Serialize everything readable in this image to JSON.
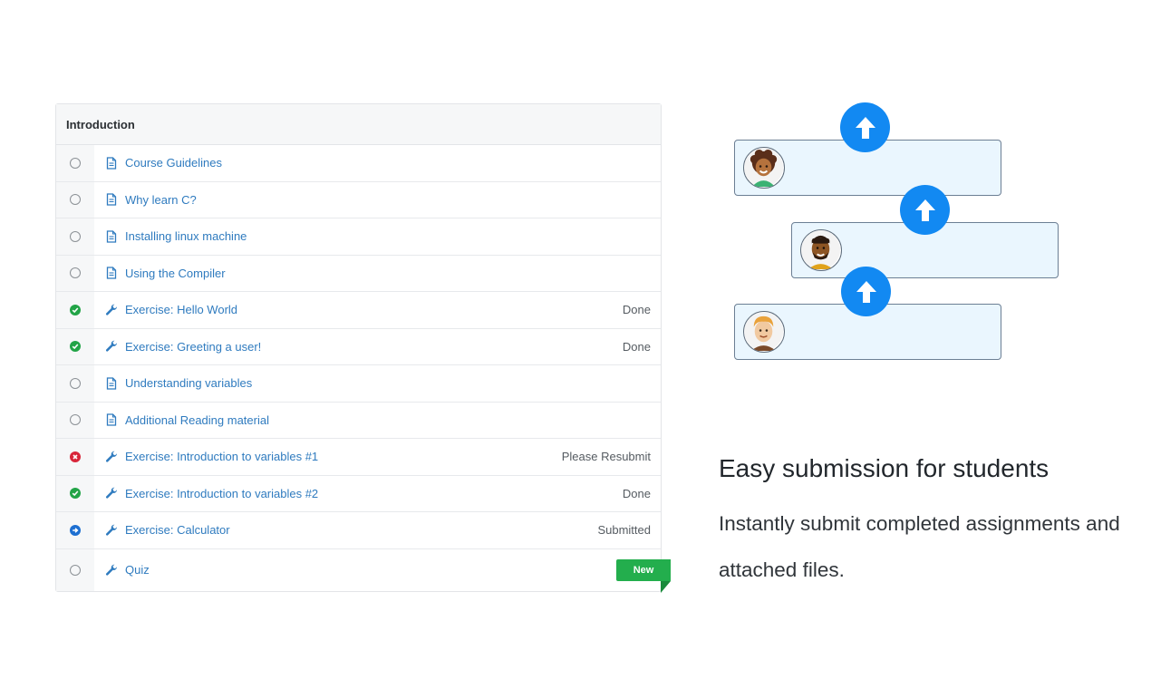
{
  "section": {
    "title": "Introduction",
    "items": [
      {
        "status": "empty",
        "type": "document-icon",
        "title": "Course Guidelines",
        "status_text": ""
      },
      {
        "status": "empty",
        "type": "document-icon",
        "title": "Why learn C?",
        "status_text": ""
      },
      {
        "status": "empty",
        "type": "document-icon",
        "title": "Installing linux machine",
        "status_text": ""
      },
      {
        "status": "empty",
        "type": "document-icon",
        "title": "Using the Compiler",
        "status_text": ""
      },
      {
        "status": "done",
        "type": "wrench-icon",
        "title": "Exercise: Hello World",
        "status_text": "Done"
      },
      {
        "status": "done",
        "type": "wrench-icon",
        "title": "Exercise: Greeting a user!",
        "status_text": "Done"
      },
      {
        "status": "empty",
        "type": "document-icon",
        "title": "Understanding variables",
        "status_text": ""
      },
      {
        "status": "empty",
        "type": "document-icon",
        "title": "Additional Reading material",
        "status_text": ""
      },
      {
        "status": "error",
        "type": "wrench-icon",
        "title": "Exercise: Introduction to variables #1",
        "status_text": "Please Resubmit"
      },
      {
        "status": "done",
        "type": "wrench-icon",
        "title": "Exercise: Introduction to variables #2",
        "status_text": "Done"
      },
      {
        "status": "submitted",
        "type": "wrench-icon",
        "title": "Exercise: Calculator",
        "status_text": "Submitted"
      },
      {
        "status": "empty",
        "type": "wrench-icon",
        "title": "Quiz",
        "status_text": "",
        "badge": "New"
      }
    ]
  },
  "feature": {
    "title": "Easy submission for students",
    "description": "Instantly submit completed assignments and attached files."
  },
  "colors": {
    "link": "#2f7bbf",
    "done": "#22a447",
    "error": "#d8263a",
    "submitted": "#1d6fd1",
    "badge": "#23ae4d",
    "upload": "#1289f2",
    "card_bg": "#eaf6fe"
  },
  "icons": {
    "upload": "arrow-up-icon",
    "student_avatars": [
      "student-avatar-curly-hair",
      "student-avatar-beard",
      "student-avatar-blond"
    ]
  }
}
